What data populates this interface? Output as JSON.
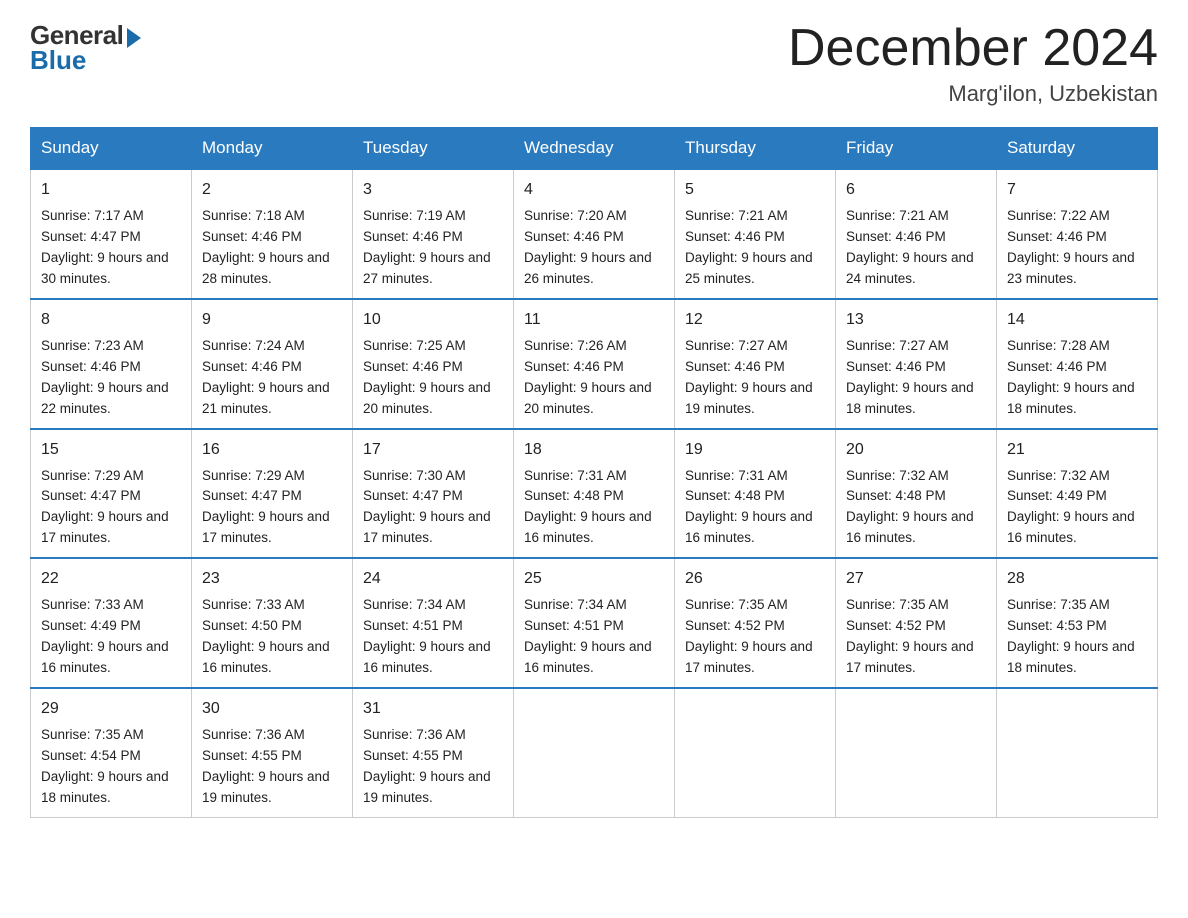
{
  "header": {
    "logo_general": "General",
    "logo_blue": "Blue",
    "month_title": "December 2024",
    "location": "Marg'ilon, Uzbekistan"
  },
  "calendar": {
    "days_of_week": [
      "Sunday",
      "Monday",
      "Tuesday",
      "Wednesday",
      "Thursday",
      "Friday",
      "Saturday"
    ],
    "weeks": [
      [
        {
          "day": "1",
          "sunrise": "7:17 AM",
          "sunset": "4:47 PM",
          "daylight": "9 hours and 30 minutes."
        },
        {
          "day": "2",
          "sunrise": "7:18 AM",
          "sunset": "4:46 PM",
          "daylight": "9 hours and 28 minutes."
        },
        {
          "day": "3",
          "sunrise": "7:19 AM",
          "sunset": "4:46 PM",
          "daylight": "9 hours and 27 minutes."
        },
        {
          "day": "4",
          "sunrise": "7:20 AM",
          "sunset": "4:46 PM",
          "daylight": "9 hours and 26 minutes."
        },
        {
          "day": "5",
          "sunrise": "7:21 AM",
          "sunset": "4:46 PM",
          "daylight": "9 hours and 25 minutes."
        },
        {
          "day": "6",
          "sunrise": "7:21 AM",
          "sunset": "4:46 PM",
          "daylight": "9 hours and 24 minutes."
        },
        {
          "day": "7",
          "sunrise": "7:22 AM",
          "sunset": "4:46 PM",
          "daylight": "9 hours and 23 minutes."
        }
      ],
      [
        {
          "day": "8",
          "sunrise": "7:23 AM",
          "sunset": "4:46 PM",
          "daylight": "9 hours and 22 minutes."
        },
        {
          "day": "9",
          "sunrise": "7:24 AM",
          "sunset": "4:46 PM",
          "daylight": "9 hours and 21 minutes."
        },
        {
          "day": "10",
          "sunrise": "7:25 AM",
          "sunset": "4:46 PM",
          "daylight": "9 hours and 20 minutes."
        },
        {
          "day": "11",
          "sunrise": "7:26 AM",
          "sunset": "4:46 PM",
          "daylight": "9 hours and 20 minutes."
        },
        {
          "day": "12",
          "sunrise": "7:27 AM",
          "sunset": "4:46 PM",
          "daylight": "9 hours and 19 minutes."
        },
        {
          "day": "13",
          "sunrise": "7:27 AM",
          "sunset": "4:46 PM",
          "daylight": "9 hours and 18 minutes."
        },
        {
          "day": "14",
          "sunrise": "7:28 AM",
          "sunset": "4:46 PM",
          "daylight": "9 hours and 18 minutes."
        }
      ],
      [
        {
          "day": "15",
          "sunrise": "7:29 AM",
          "sunset": "4:47 PM",
          "daylight": "9 hours and 17 minutes."
        },
        {
          "day": "16",
          "sunrise": "7:29 AM",
          "sunset": "4:47 PM",
          "daylight": "9 hours and 17 minutes."
        },
        {
          "day": "17",
          "sunrise": "7:30 AM",
          "sunset": "4:47 PM",
          "daylight": "9 hours and 17 minutes."
        },
        {
          "day": "18",
          "sunrise": "7:31 AM",
          "sunset": "4:48 PM",
          "daylight": "9 hours and 16 minutes."
        },
        {
          "day": "19",
          "sunrise": "7:31 AM",
          "sunset": "4:48 PM",
          "daylight": "9 hours and 16 minutes."
        },
        {
          "day": "20",
          "sunrise": "7:32 AM",
          "sunset": "4:48 PM",
          "daylight": "9 hours and 16 minutes."
        },
        {
          "day": "21",
          "sunrise": "7:32 AM",
          "sunset": "4:49 PM",
          "daylight": "9 hours and 16 minutes."
        }
      ],
      [
        {
          "day": "22",
          "sunrise": "7:33 AM",
          "sunset": "4:49 PM",
          "daylight": "9 hours and 16 minutes."
        },
        {
          "day": "23",
          "sunrise": "7:33 AM",
          "sunset": "4:50 PM",
          "daylight": "9 hours and 16 minutes."
        },
        {
          "day": "24",
          "sunrise": "7:34 AM",
          "sunset": "4:51 PM",
          "daylight": "9 hours and 16 minutes."
        },
        {
          "day": "25",
          "sunrise": "7:34 AM",
          "sunset": "4:51 PM",
          "daylight": "9 hours and 16 minutes."
        },
        {
          "day": "26",
          "sunrise": "7:35 AM",
          "sunset": "4:52 PM",
          "daylight": "9 hours and 17 minutes."
        },
        {
          "day": "27",
          "sunrise": "7:35 AM",
          "sunset": "4:52 PM",
          "daylight": "9 hours and 17 minutes."
        },
        {
          "day": "28",
          "sunrise": "7:35 AM",
          "sunset": "4:53 PM",
          "daylight": "9 hours and 18 minutes."
        }
      ],
      [
        {
          "day": "29",
          "sunrise": "7:35 AM",
          "sunset": "4:54 PM",
          "daylight": "9 hours and 18 minutes."
        },
        {
          "day": "30",
          "sunrise": "7:36 AM",
          "sunset": "4:55 PM",
          "daylight": "9 hours and 19 minutes."
        },
        {
          "day": "31",
          "sunrise": "7:36 AM",
          "sunset": "4:55 PM",
          "daylight": "9 hours and 19 minutes."
        },
        null,
        null,
        null,
        null
      ]
    ]
  }
}
